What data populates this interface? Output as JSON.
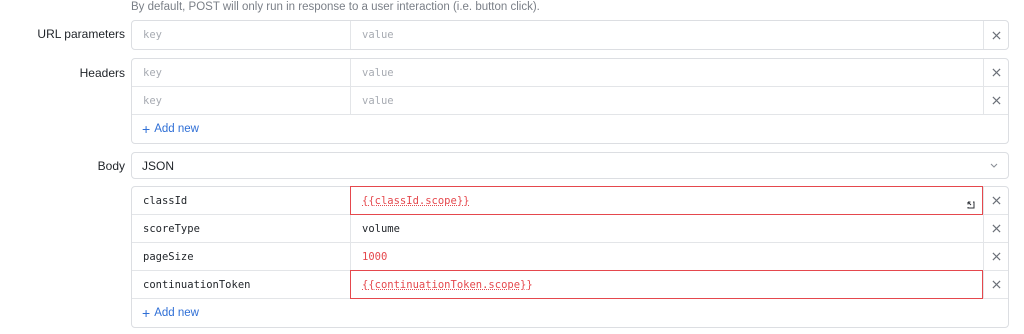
{
  "hint": "By default, POST will only run in response to a user interaction (i.e. button click).",
  "url_params": {
    "label": "URL parameters",
    "rows": [
      {
        "key_placeholder": "key",
        "value_placeholder": "value"
      }
    ]
  },
  "headers": {
    "label": "Headers",
    "rows": [
      {
        "key_placeholder": "key",
        "value_placeholder": "value"
      },
      {
        "key_placeholder": "key",
        "value_placeholder": "value"
      }
    ],
    "add_label": "Add new"
  },
  "body": {
    "label": "Body",
    "type_selected": "JSON",
    "rows": [
      {
        "key": "classId",
        "value": "{{classId.scope}}"
      },
      {
        "key": "scoreType",
        "value": "volume"
      },
      {
        "key": "pageSize",
        "value": "1000"
      },
      {
        "key": "continuationToken",
        "value": "{{continuationToken.scope}}"
      }
    ],
    "add_label": "Add new"
  },
  "icons": {
    "delete": "close-icon",
    "dropdown": "chevron-down-icon",
    "expand": "expand-icon",
    "add": "plus-icon"
  },
  "colors": {
    "error": "#e5484d",
    "link": "#2f6fd6",
    "border": "#dcdee2"
  }
}
